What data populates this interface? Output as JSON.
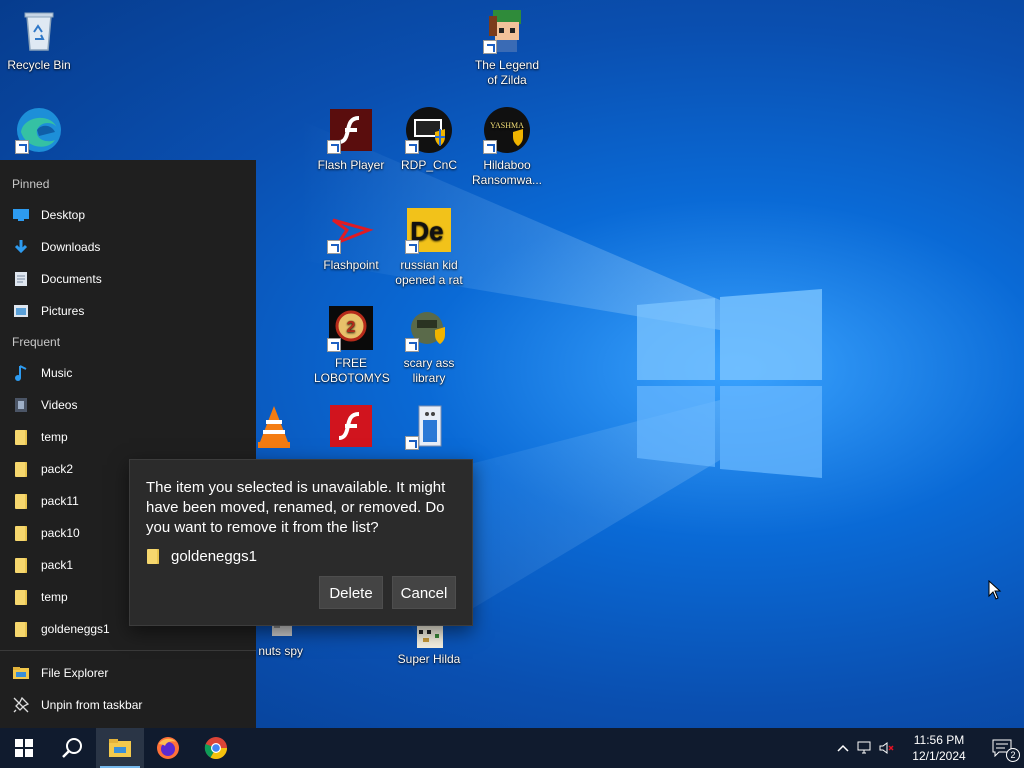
{
  "desktop": {
    "icons": [
      {
        "id": "recycle",
        "label": "Recycle Bin"
      },
      {
        "id": "edge",
        "label": ""
      },
      {
        "id": "zilda",
        "label": "The Legend of Zilda"
      },
      {
        "id": "flash",
        "label": "Flash Player"
      },
      {
        "id": "rdp",
        "label": "RDP_CnC"
      },
      {
        "id": "hildaboo",
        "label": "Hildaboo Ransomwa..."
      },
      {
        "id": "flashpoint",
        "label": "Flashpoint"
      },
      {
        "id": "russian",
        "label": "russian kid opened a rat"
      },
      {
        "id": "lobotomys",
        "label": "FREE LOBOTOMYS"
      },
      {
        "id": "scary",
        "label": "scary ass library"
      },
      {
        "id": "vlc",
        "label": ""
      },
      {
        "id": "flash2",
        "label": ""
      },
      {
        "id": "app3",
        "label": ""
      },
      {
        "id": "nuts",
        "label": "z nuts spy"
      },
      {
        "id": "superhilda",
        "label": "Super Hilda"
      }
    ]
  },
  "jumplist": {
    "pinned_header": "Pinned",
    "pinned": [
      {
        "label": "Desktop",
        "icon": "desktop-icon"
      },
      {
        "label": "Downloads",
        "icon": "download-icon"
      },
      {
        "label": "Documents",
        "icon": "documents-icon"
      },
      {
        "label": "Pictures",
        "icon": "pictures-icon"
      }
    ],
    "frequent_header": "Frequent",
    "frequent": [
      {
        "label": "Music",
        "icon": "music-icon"
      },
      {
        "label": "Videos",
        "icon": "videos-icon"
      },
      {
        "label": "temp",
        "icon": "folder-icon"
      },
      {
        "label": "pack2",
        "icon": "folder-icon"
      },
      {
        "label": "pack11",
        "icon": "folder-icon"
      },
      {
        "label": "pack10",
        "icon": "folder-icon"
      },
      {
        "label": "pack1",
        "icon": "folder-icon"
      },
      {
        "label": "temp",
        "icon": "folder-icon"
      },
      {
        "label": "goldeneggs1",
        "icon": "folder-icon"
      }
    ],
    "actions": [
      {
        "label": "File Explorer",
        "icon": "file-explorer-icon"
      },
      {
        "label": "Unpin from taskbar",
        "icon": "unpin-icon"
      }
    ]
  },
  "dialog": {
    "message": "The item you selected is unavailable. It might have been moved, renamed, or removed. Do you want to remove it from the list?",
    "item": "goldeneggs1",
    "delete_label": "Delete",
    "cancel_label": "Cancel"
  },
  "taskbar": {
    "time": "11:56 PM",
    "date": "12/1/2024",
    "notification_count": "2"
  }
}
